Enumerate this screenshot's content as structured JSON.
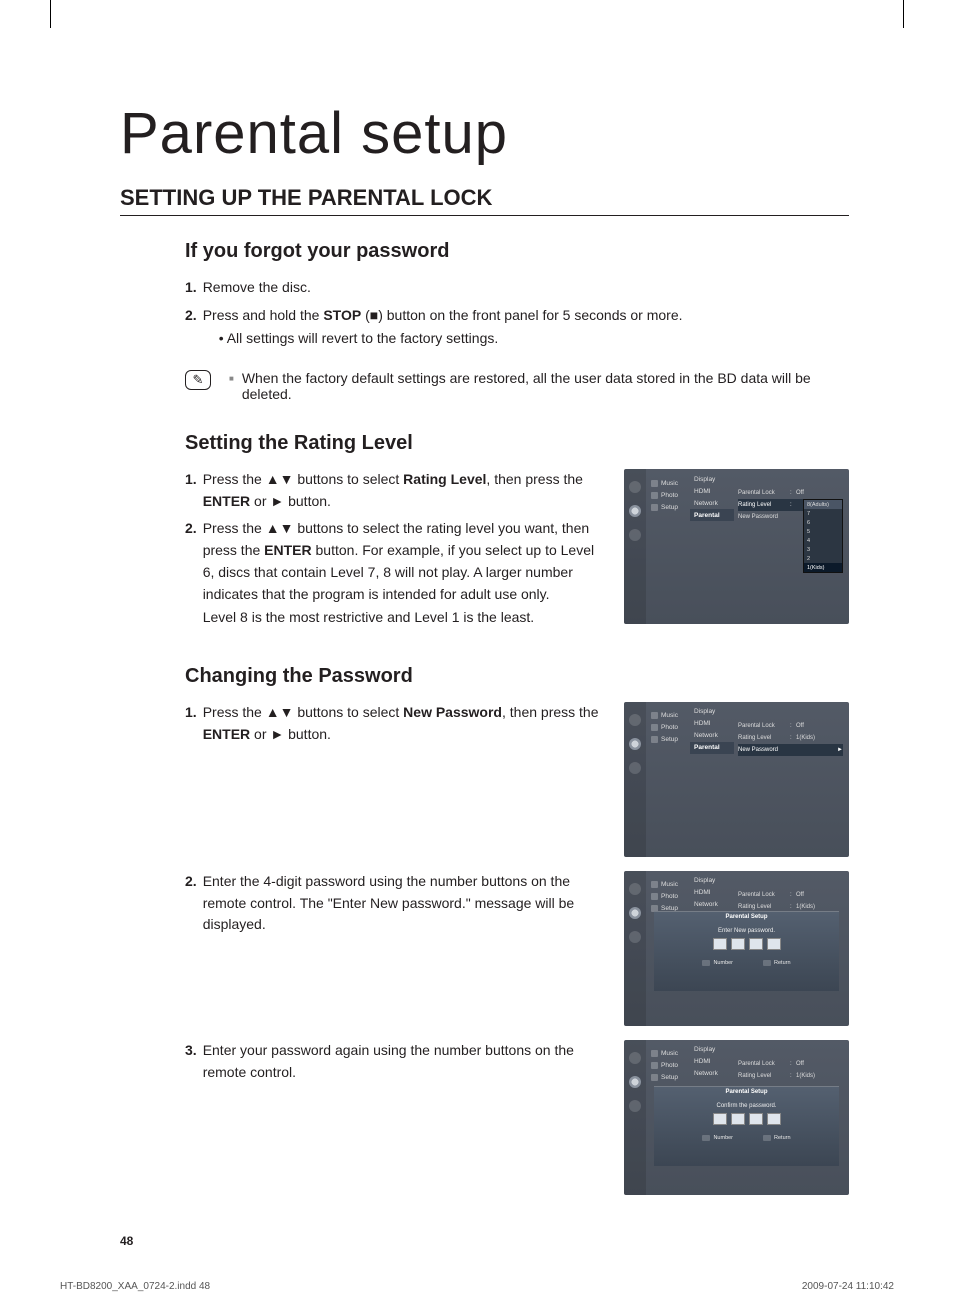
{
  "title": "Parental setup",
  "section": "SETTING UP THE PARENTAL LOCK",
  "forgot": {
    "heading": "If you forgot your password",
    "step1": "Remove the disc.",
    "step2_a": "Press and hold the ",
    "step2_b": "STOP",
    "step2_c": " (■) button on the front panel for 5 seconds or more.",
    "step2_bullet": "• All settings will revert to the factory settings.",
    "note": "When the factory default settings are restored, all the user data stored in the BD data will be deleted."
  },
  "rating": {
    "heading": "Setting the Rating Level",
    "step1_a": "Press the ▲▼ buttons to select ",
    "step1_b": "Rating Level",
    "step1_c": ", then press the ",
    "step1_d": "ENTER",
    "step1_e": " or ► button.",
    "step2_a": "Press the ▲▼ buttons to select the rating level you want, then press the ",
    "step2_b": "ENTER",
    "step2_c": " button. For example, if you select up to Level 6, discs that contain Level 7, 8 will not play. A larger number indicates that the program is intended for adult use only.",
    "step2_tail": "Level 8 is the most restrictive and Level 1 is the least."
  },
  "password": {
    "heading": "Changing the Password",
    "step1_a": "Press the ▲▼ buttons to select ",
    "step1_b": "New Password",
    "step1_c": ", then press the ",
    "step1_d": "ENTER",
    "step1_e": " or ► button.",
    "step2": "Enter the 4-digit password using the number buttons on the remote control. The \"Enter New password.\" message will be displayed.",
    "step3": "Enter your password again using the number buttons on the remote control."
  },
  "osd": {
    "tabs": {
      "music": "Music",
      "photo": "Photo",
      "setup": "Setup"
    },
    "menu": {
      "display": "Display",
      "hdmi": "HDMI",
      "network": "Network",
      "parental": "Parental"
    },
    "rows": {
      "lock": "Parental Lock",
      "lockv": "Off",
      "level": "Rating Level",
      "levelv": "1(Kids)",
      "pass": "New Password"
    },
    "levels": [
      "8(Adults)",
      "7",
      "6",
      "5",
      "4",
      "3",
      "2",
      "1(Kids)"
    ],
    "modal": {
      "title": "Parental Setup",
      "enter": "Enter New password.",
      "confirm": "Confirm the password.",
      "number": "Number",
      "return": "Return"
    }
  },
  "page_num": "48",
  "footer_left": "HT-BD8200_XAA_0724-2.indd   48",
  "footer_right": "2009-07-24     11:10:42"
}
